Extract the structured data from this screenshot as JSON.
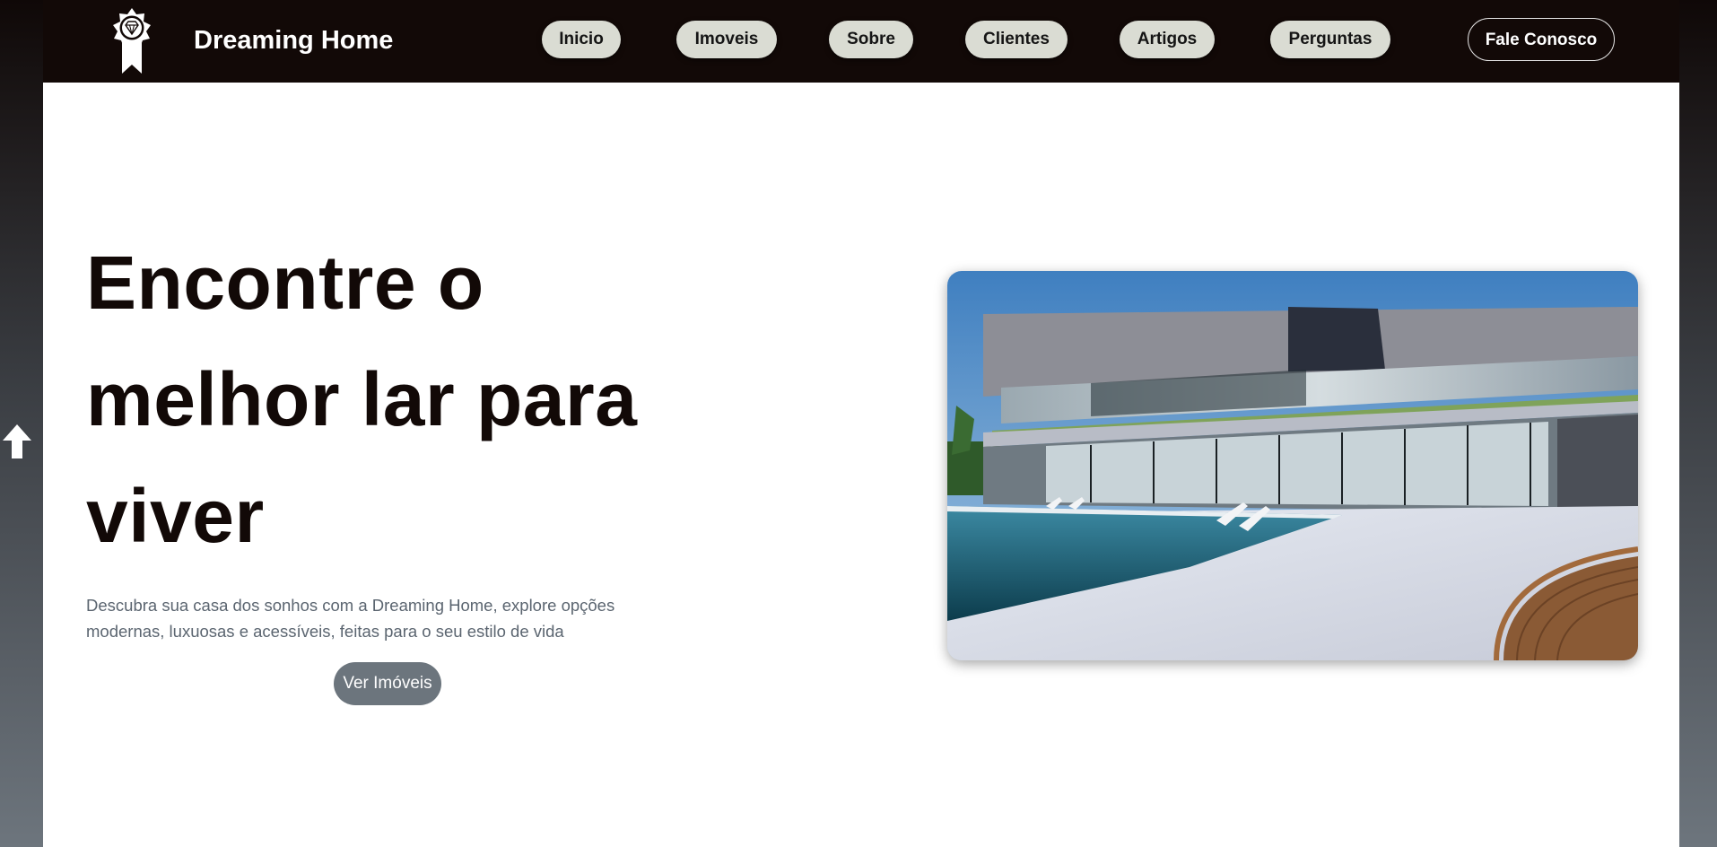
{
  "header": {
    "brand": "Dreaming Home",
    "logo_icon": "diamond-ribbon-badge-icon",
    "nav": [
      {
        "label": "Inicio"
      },
      {
        "label": "Imoveis"
      },
      {
        "label": "Sobre"
      },
      {
        "label": "Clientes"
      },
      {
        "label": "Artigos"
      },
      {
        "label": "Perguntas"
      }
    ],
    "contact_label": "Fale Conosco"
  },
  "hero": {
    "title": "Encontre o melhor lar para viver",
    "description": "Descubra sua casa dos sonhos com a Dreaming Home, explore opções modernas, luxuosas e acessíveis, feitas para o seu estilo de vida",
    "button_label": "Ver Imóveis",
    "image_subject": "modern-house-with-pool"
  },
  "scroll_top_icon": "arrow-up-icon",
  "colors": {
    "header_bg": "#120907",
    "nav_pill_bg": "#dadcd3",
    "button_bg": "#6c757d",
    "title_color": "#120907",
    "desc_color": "#5b6570"
  }
}
